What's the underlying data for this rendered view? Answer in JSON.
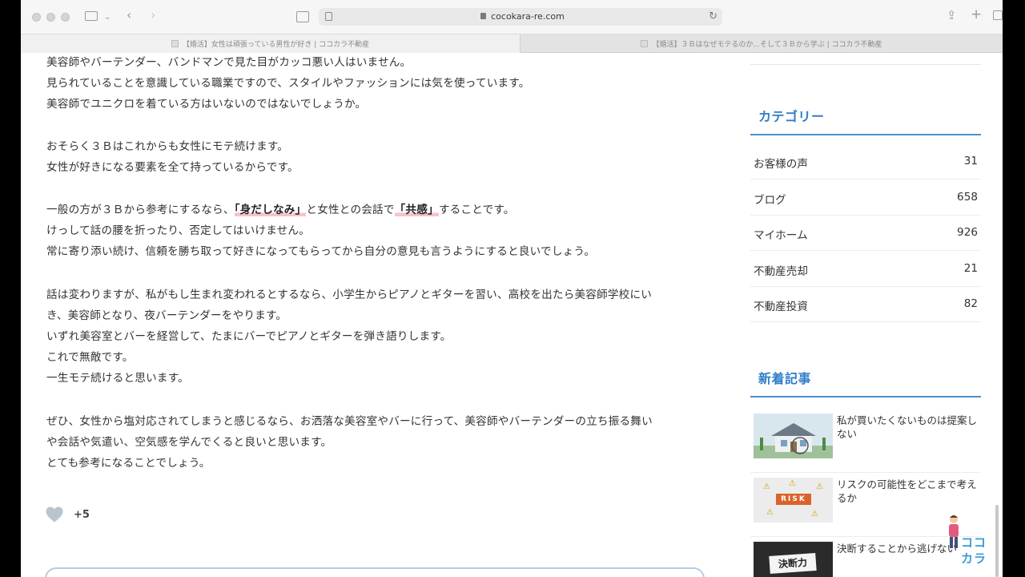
{
  "browser": {
    "url": "cocokara-re.com",
    "tabs": [
      {
        "label": "【婚活】女性は頑張っている男性が好き | ココカラ不動産",
        "active": true
      },
      {
        "label": "【婚活】３Ｂはなぜモテるのか...そして３Ｂから学ぶ | ココカラ不動産",
        "active": false
      }
    ]
  },
  "article": {
    "lines": [
      {
        "text": "美容師やバーテンダー、バンドマンで見た目がカッコ悪い人はいません。"
      },
      {
        "text": "見られていることを意識している職業ですので、スタイルやファッションには気を使っています。"
      },
      {
        "text": "美容師でユニクロを着ている方はいないのではないでしょうか。"
      },
      {
        "text": "おそらく３Ｂはこれからも女性にモテ続けます。"
      },
      {
        "text": "女性が好きになる要素を全て持っているからです。"
      },
      {
        "pre": "一般の方が３Ｂから参考にするなら、",
        "hl1": "「身だしなみ」",
        "mid": "と女性との会話で",
        "hl2": "「共感」",
        "post": "することです。"
      },
      {
        "text": "けっして話の腰を折ったり、否定してはいけません。"
      },
      {
        "text": "常に寄り添い続け、信頼を勝ち取って好きになってもらってから自分の意見も言うようにすると良いでしょう。"
      },
      {
        "text": "話は変わりますが、私がもし生まれ変われるとするなら、小学生からピアノとギターを習い、高校を出たら美容師学校にい"
      },
      {
        "text": "き、美容師となり、夜バーテンダーをやります。"
      },
      {
        "text": "いずれ美容室とバーを経営して、たまにバーでピアノとギターを弾き語りします。"
      },
      {
        "text": "これで無敵です。"
      },
      {
        "text": "一生モテ続けると思います。"
      },
      {
        "text": "ぜひ、女性から塩対応されてしまうと感じるなら、お洒落な美容室やバーに行って、美容師やバーテンダーの立ち振る舞い"
      },
      {
        "text": "や会話や気遣い、空気感を学んでくると良いと思います。"
      },
      {
        "text": "とても参考になることでしょう。"
      }
    ],
    "like_count": "+5"
  },
  "sidebar": {
    "categories_title": "カテゴリー",
    "categories": [
      {
        "name": "お客様の声",
        "count": "31"
      },
      {
        "name": "ブログ",
        "count": "658"
      },
      {
        "name": "マイホーム",
        "count": "926"
      },
      {
        "name": "不動産売却",
        "count": "21"
      },
      {
        "name": "不動産投資",
        "count": "82"
      }
    ],
    "recent_title": "新着記事",
    "recent_posts": [
      {
        "title": "私が買いたくないものは提案しない",
        "thumb": "house"
      },
      {
        "title": "リスクの可能性をどこまで考えるか",
        "thumb": "risk",
        "thumb_text": "RISK"
      },
      {
        "title": "決断することから逃げない",
        "thumb": "decision",
        "thumb_text": "決断力"
      }
    ]
  },
  "logo": {
    "line1": "ココ",
    "line2": "カラ"
  },
  "colors": {
    "accent": "#2f7ec9",
    "highlight": "#f7c3c7",
    "heart": "#b9c4cc"
  }
}
